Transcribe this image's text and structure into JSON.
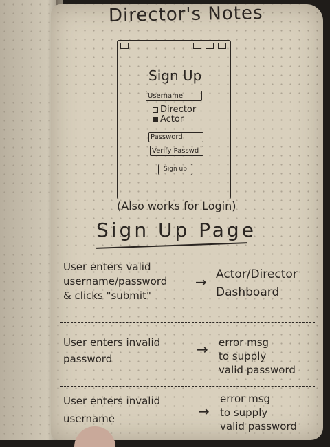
{
  "notebook": {
    "title": "Director's Notes"
  },
  "wireframe": {
    "heading": "Sign Up",
    "username_field": "Username",
    "role_options": [
      {
        "label": "Director",
        "checked": false
      },
      {
        "label": "Actor",
        "checked": true
      }
    ],
    "password_field": "Password",
    "verify_field": "Verify Passwd",
    "submit_label": "Sign up"
  },
  "caption": "(Also works for Login)",
  "page_label": "Sign Up Page",
  "scenarios": [
    {
      "condition_lines": [
        "User enters valid",
        "username/password",
        "& clicks \"submit\""
      ],
      "arrow": "→",
      "result_lines": [
        "Actor/Director",
        "Dashboard"
      ]
    },
    {
      "condition_lines": [
        "User enters invalid",
        "password"
      ],
      "arrow": "→",
      "result_lines": [
        "error msg",
        "to supply",
        "valid password"
      ]
    },
    {
      "condition_lines": [
        "User enters invalid",
        "username"
      ],
      "arrow": "→",
      "result_lines": [
        "error msg",
        "to supply",
        "valid password"
      ]
    }
  ]
}
